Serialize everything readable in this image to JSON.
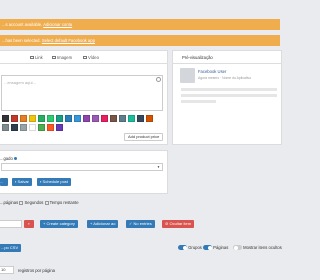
{
  "banners": {
    "first_text": "...s account available.",
    "first_link": "Adicionar conta",
    "second_text": "...has been selected.",
    "second_link": "Select default Facebook app"
  },
  "composer": {
    "tabs": [
      {
        "label": "Link",
        "icon": "link-icon"
      },
      {
        "label": "Imagem",
        "icon": "image-icon"
      },
      {
        "label": "Vídeo",
        "icon": "video-icon"
      }
    ],
    "placeholder": "...ensagem aqui...",
    "add_product_label": "Add product price",
    "colors": [
      "#333333",
      "#c0392b",
      "#e67e22",
      "#f1c40f",
      "#27ae60",
      "#2ecc71",
      "#16a085",
      "#2980b9",
      "#3498db",
      "#8e44ad",
      "#9b59b6",
      "#e91e63",
      "#795548",
      "#607d8b",
      "#1abc9c",
      "#34495e",
      "#d35400",
      "#7f8c8d",
      "#2c3e50",
      "#95a5a6",
      "#ffffff",
      "#4caf50",
      "#ff5722",
      "#673ab7"
    ]
  },
  "preview": {
    "title": "Pré-visualização",
    "user_name": "Facebook User",
    "user_meta": "Agora mesmo · Nome do Aplicativo"
  },
  "schedule": {
    "field_label": "...gado",
    "post_button": "...",
    "save_button": "Salvar",
    "schedule_button": "Schedule post"
  },
  "pages": {
    "interval_prefix": "...páginas",
    "interval_unit": "Segundos",
    "interval_note": "Tempo restante",
    "create_category": "Create category",
    "add_to": "Adicionar ao",
    "no_selected": "No entries",
    "hide_selected": "Ocultar item",
    "import_csv": "...po CSV",
    "toggle_groups": "Grupos",
    "toggle_pages": "Páginas",
    "toggle_hidden": "Mostrar itens ocultos",
    "per_page_label": "registros por página",
    "per_page_value": "10"
  }
}
